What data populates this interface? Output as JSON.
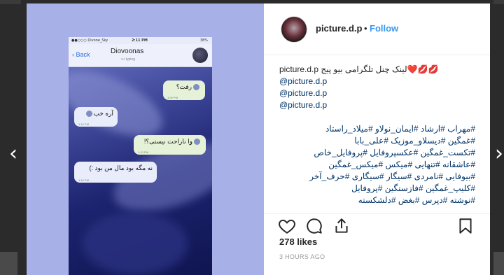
{
  "page": {
    "nav_prev_icon": "chevron-left-icon",
    "nav_next_icon": "chevron-right-icon"
  },
  "post": {
    "username": "picture.d.p",
    "separator": "•",
    "follow_label": "Follow",
    "caption_first_line": "picture.d.p لینک چنل تلگرامی بیو پیج❤️💋💋",
    "caption_lines": [
      "@picture.d.p",
      "@picture.d.p",
      "@picture.d.p",
      "",
      "#مهراب #ارشاد #ایمان_نولاو #میلاد_راستاد",
      "#غمگین #دیسلاو_موزیک #علی_بابا",
      "#تکست_غمگین #عکسپروفایل #پروفایل_خاص",
      "#عاشقانه #تنهایی #میکس #میکس_غمگین",
      "#بیوفایی #نامردی #سیگار #سیگاری #حرف_آخر",
      "#کلیپ_غمگین #فازسنگین #پروفایل",
      "#نوشته #دپرس #بغض #دلشکسته"
    ],
    "likes": "278 likes",
    "timestamp": "3 HOURS AGO",
    "icons": {
      "like": "heart-icon",
      "comment": "comment-icon",
      "share": "share-icon",
      "save": "bookmark-icon"
    }
  },
  "media": {
    "status_carrier": "●●○○○ Divone_Sky",
    "status_time": "2:11 PM",
    "status_battery": "38%",
    "chat_back": "Back",
    "chat_title": "Diovoonas",
    "chat_subtitle": "••• typing",
    "messages": [
      {
        "text": "رفت؟",
        "meta": "1:09 PM",
        "direction": "out"
      },
      {
        "text": "آره خب",
        "meta": "1:10 PM",
        "direction": "in"
      },
      {
        "text": "وا ناراحت نیستی؟!",
        "meta": "1:10 PM",
        "direction": "out"
      },
      {
        "text": "نه مگه بود مال من بود :)",
        "meta": "1:10 PM",
        "direction": "in"
      }
    ]
  }
}
